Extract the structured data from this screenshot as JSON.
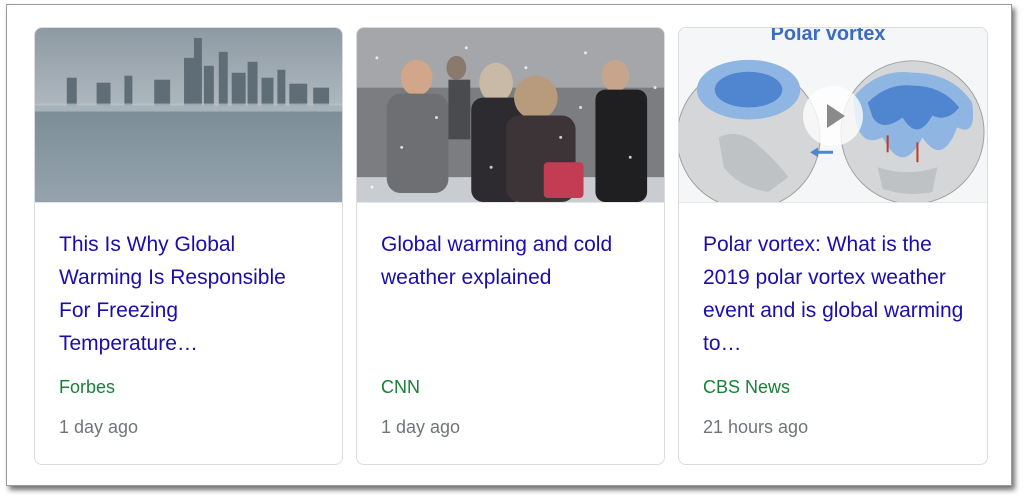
{
  "cards": [
    {
      "headline": "This Is Why Global Warming Is Responsible For Freezing Temperature…",
      "source": "Forbes",
      "time": "1 day ago",
      "thumbnail": "foggy-city-skyline-image"
    },
    {
      "headline": "Global warming and cold weather explained",
      "source": "CNN",
      "time": "1 day ago",
      "thumbnail": "people-walking-in-snow-image"
    },
    {
      "headline": "Polar vortex: What is the 2019 polar vortex weather event and is global warming to…",
      "source": "CBS News",
      "time": "21 hours ago",
      "thumbnail": "polar-vortex-diagram-image",
      "thumbnail_text": "Polar vortex",
      "has_video": true
    }
  ],
  "colors": {
    "headline": "#1a0dab",
    "source": "#188038",
    "time": "#70757a"
  }
}
